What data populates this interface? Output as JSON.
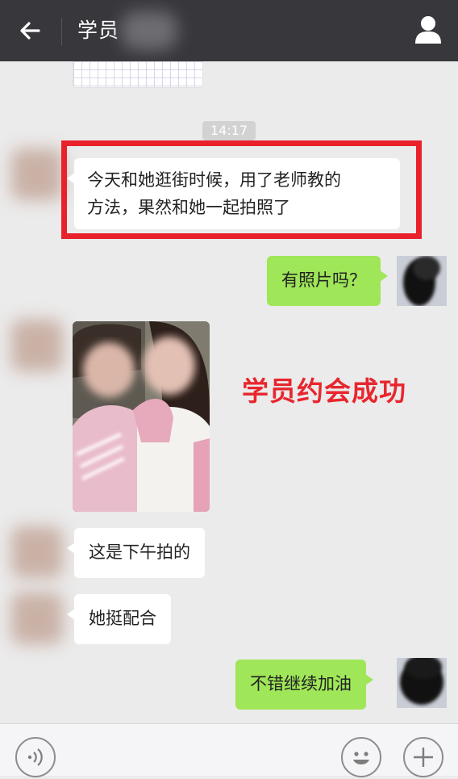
{
  "header": {
    "title": "学员",
    "back_icon": "arrow-left-icon",
    "profile_icon": "person-icon"
  },
  "chat": {
    "timestamp": "14:17",
    "messages": [
      {
        "side": "left",
        "text": "今天和她逛街时候，用了老师教的方法，果然和她一起拍照了"
      },
      {
        "side": "right",
        "text": "有照片吗？"
      },
      {
        "side": "left",
        "type": "image"
      },
      {
        "side": "left",
        "text": "这是下午拍的"
      },
      {
        "side": "left",
        "text": "她挺配合"
      },
      {
        "side": "right",
        "text": "不错继续加油"
      }
    ],
    "highlight_text_line1": "今天和她逛街时候，用了老师教的",
    "highlight_text_line2": "方法，果然和她一起拍照了"
  },
  "annotation": {
    "text": "学员约会成功",
    "color": "#e8262e"
  },
  "input_bar": {
    "voice_icon": "voice-icon",
    "emoji_icon": "smiley-icon",
    "more_icon": "plus-icon"
  },
  "colors": {
    "header_bg": "#38383c",
    "chat_bg": "#ebebeb",
    "outgoing_bubble": "#9fe658",
    "incoming_bubble": "#ffffff",
    "highlight_border": "#e8212b"
  }
}
